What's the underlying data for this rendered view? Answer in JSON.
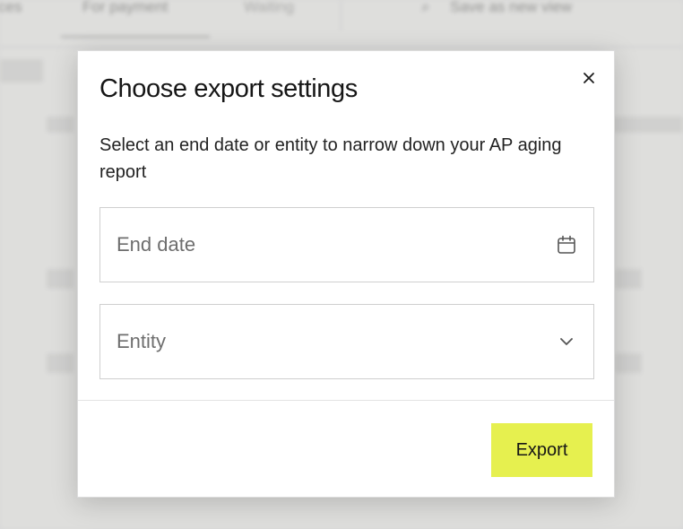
{
  "background": {
    "nav_items": [
      "ces",
      "For payment",
      "Waiting",
      "Save as new view"
    ],
    "nav_search_icon": "search-icon"
  },
  "modal": {
    "title": "Choose export settings",
    "description": "Select an end date or entity to narrow down your AP aging report",
    "close_icon": "close-icon",
    "end_date": {
      "placeholder": "End date",
      "value": "",
      "icon": "calendar-icon"
    },
    "entity": {
      "placeholder": "Entity",
      "selected": "",
      "icon": "chevron-down-icon"
    },
    "export_label": "Export"
  },
  "colors": {
    "accent": "#e6f04f",
    "text": "#161616",
    "placeholder": "#6e6e6e",
    "border": "#cfcfcf"
  }
}
